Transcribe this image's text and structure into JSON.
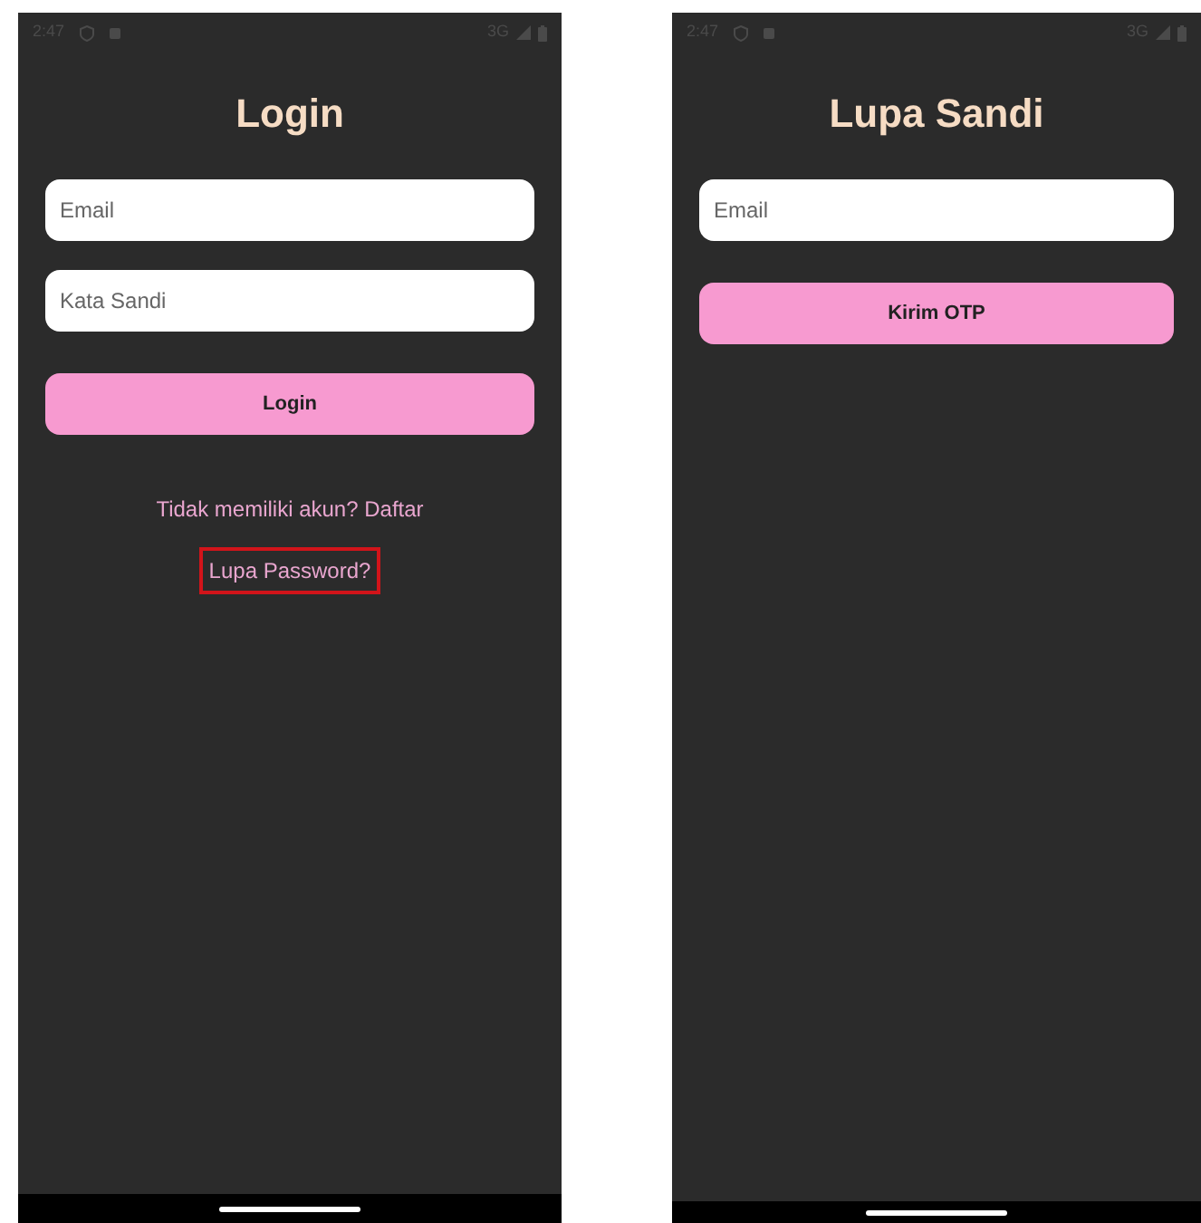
{
  "screens": [
    {
      "status_bar": {
        "time": "2:47",
        "network": "3G"
      },
      "title": "Login",
      "fields": [
        {
          "placeholder": "Email"
        },
        {
          "placeholder": "Kata Sandi"
        }
      ],
      "button": "Login",
      "links": [
        {
          "text": "Tidak memiliki akun? Daftar",
          "highlighted": false
        },
        {
          "text": "Lupa Password?",
          "highlighted": true
        }
      ]
    },
    {
      "status_bar": {
        "time": "2:47",
        "network": "3G"
      },
      "title": "Lupa Sandi",
      "fields": [
        {
          "placeholder": "Email"
        }
      ],
      "button": "Kirim OTP"
    }
  ]
}
